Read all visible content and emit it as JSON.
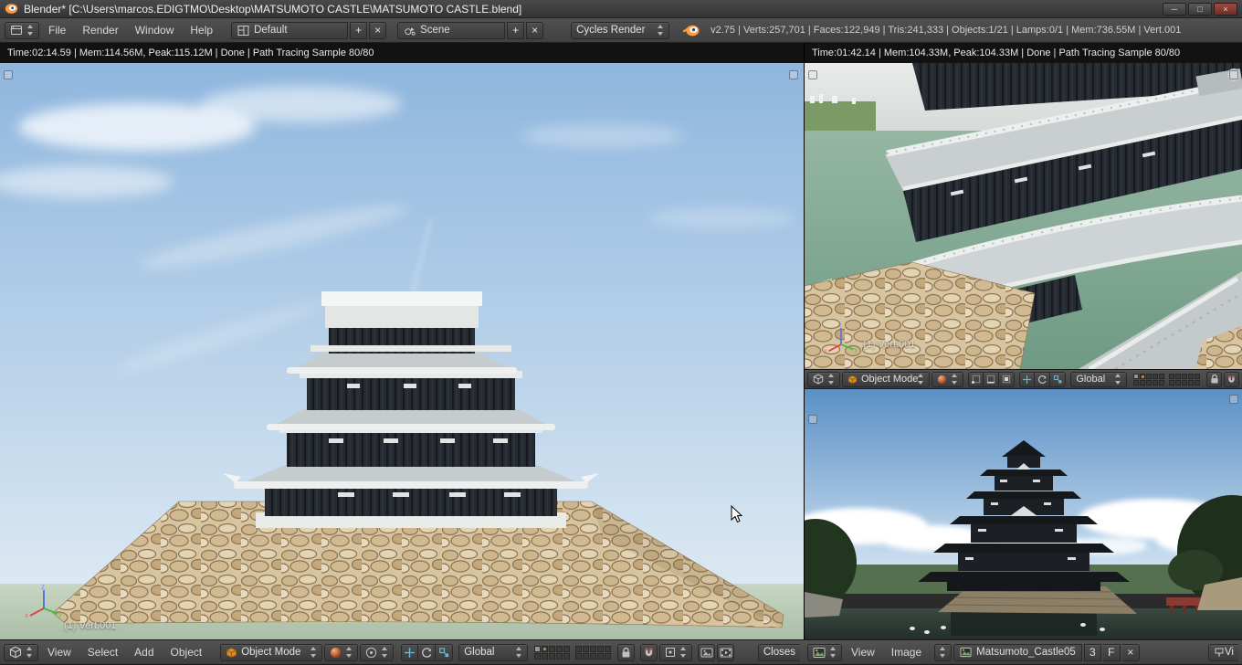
{
  "glyphs": {
    "plus": "+",
    "close": "×",
    "minimize": "─",
    "restore": "□"
  },
  "titlebar": {
    "title": "Blender* [C:\\Users\\marcos.EDIGTMO\\Desktop\\MATSUMOTO CASTLE\\MATSUMOTO CASTLE.blend]"
  },
  "info_header": {
    "menus": [
      {
        "label": "File"
      },
      {
        "label": "Render"
      },
      {
        "label": "Window"
      },
      {
        "label": "Help"
      }
    ],
    "layout": {
      "value": "Default"
    },
    "scene": {
      "value": "Scene"
    },
    "engine": {
      "value": "Cycles Render"
    },
    "stats": "v2.75 | Verts:257,701 | Faces:122,949 | Tris:241,333 | Objects:1/21 | Lamps:0/1 | Mem:736.55M | Vert.001"
  },
  "main_viewport": {
    "render_status": "Time:02:14.59 | Mem:114.56M, Peak:115.12M | Done | Path Tracing Sample 80/80",
    "object_label": "(1) Vert.001",
    "header": {
      "menus": [
        {
          "label": "View"
        },
        {
          "label": "Select"
        },
        {
          "label": "Add"
        },
        {
          "label": "Object"
        }
      ],
      "mode": "Object Mode",
      "orientation": "Global",
      "snap_mode": "Closes"
    }
  },
  "secondary_viewport": {
    "render_status": "Time:01:42.14 | Mem:104.33M, Peak:104.33M | Done | Path Tracing Sample 80/80",
    "object_label": "(1) Vert.001",
    "header": {
      "mode": "Object Mode",
      "orientation": "Global"
    }
  },
  "image_editor": {
    "header": {
      "menus": [
        {
          "label": "View"
        },
        {
          "label": "Image"
        }
      ],
      "image_name": "Matsumoto_Castle05",
      "users_count": "3",
      "fake_user": "F",
      "truncated_label": "Vi"
    }
  },
  "gizmo": {
    "x": "x",
    "y": "y",
    "z": "z"
  }
}
